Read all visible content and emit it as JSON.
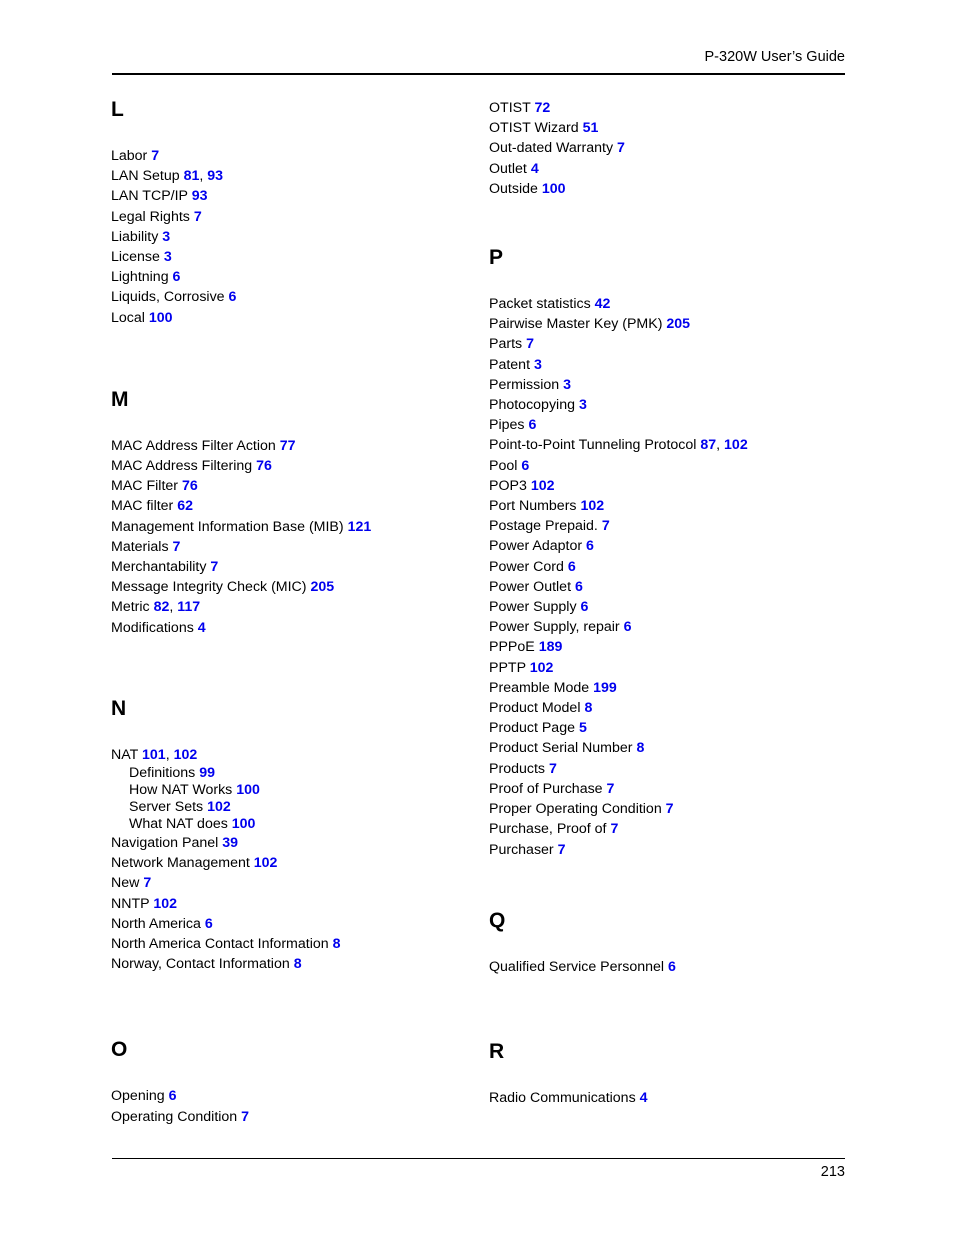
{
  "header": {
    "title": "P-320W User’s Guide"
  },
  "footer": {
    "page_number": "213"
  },
  "colors": {
    "page_reference": "#0000ee",
    "text": "#000000",
    "background": "#ffffff"
  },
  "columns": {
    "left": [
      {
        "letter": "L",
        "gap_before": 0,
        "entries": [
          {
            "term": "Labor",
            "pages": [
              "7"
            ]
          },
          {
            "term": "LAN Setup",
            "pages": [
              "81",
              "93"
            ]
          },
          {
            "term": "LAN TCP/IP",
            "pages": [
              "93"
            ]
          },
          {
            "term": "Legal Rights",
            "pages": [
              "7"
            ]
          },
          {
            "term": "Liability",
            "pages": [
              "3"
            ]
          },
          {
            "term": "License",
            "pages": [
              "3"
            ]
          },
          {
            "term": "Lightning",
            "pages": [
              "6"
            ]
          },
          {
            "term": "Liquids, Corrosive",
            "pages": [
              "6"
            ]
          },
          {
            "term": "Local",
            "pages": [
              "100"
            ]
          }
        ]
      },
      {
        "letter": "M",
        "gap_before": 60,
        "entries": [
          {
            "term": "MAC Address Filter Action",
            "pages": [
              "77"
            ]
          },
          {
            "term": "MAC Address Filtering",
            "pages": [
              "76"
            ]
          },
          {
            "term": "MAC Filter",
            "pages": [
              "76"
            ]
          },
          {
            "term": "MAC filter",
            "pages": [
              "62"
            ]
          },
          {
            "term": "Management Information Base (MIB)",
            "pages": [
              "121"
            ]
          },
          {
            "term": "Materials",
            "pages": [
              "7"
            ]
          },
          {
            "term": "Merchantability",
            "pages": [
              "7"
            ]
          },
          {
            "term": "Message Integrity Check (MIC)",
            "pages": [
              "205"
            ]
          },
          {
            "term": "Metric",
            "pages": [
              "82",
              "117"
            ]
          },
          {
            "term": "Modifications",
            "pages": [
              "4"
            ]
          }
        ]
      },
      {
        "letter": "N",
        "gap_before": 59,
        "entries": [
          {
            "term": "NAT",
            "pages": [
              "101",
              "102"
            ]
          },
          {
            "term": "Definitions",
            "pages": [
              "99"
            ],
            "sub": true
          },
          {
            "term": "How NAT Works",
            "pages": [
              "100"
            ],
            "sub": true
          },
          {
            "term": "Server Sets",
            "pages": [
              "102"
            ],
            "sub": true
          },
          {
            "term": "What NAT does",
            "pages": [
              "100"
            ],
            "sub": true
          },
          {
            "term": "Navigation Panel",
            "pages": [
              "39"
            ]
          },
          {
            "term": "Network Management",
            "pages": [
              "102"
            ]
          },
          {
            "term": "New",
            "pages": [
              "7"
            ]
          },
          {
            "term": "NNTP",
            "pages": [
              "102"
            ]
          },
          {
            "term": "North America",
            "pages": [
              "6"
            ]
          },
          {
            "term": "North America Contact Information",
            "pages": [
              "8"
            ]
          },
          {
            "term": "Norway, Contact Information",
            "pages": [
              "8"
            ]
          }
        ]
      },
      {
        "letter": "O",
        "gap_before": 64,
        "entries": [
          {
            "term": "Opening",
            "pages": [
              "6"
            ]
          },
          {
            "term": "Operating Condition",
            "pages": [
              "7"
            ]
          }
        ]
      }
    ],
    "right": [
      {
        "letter": "",
        "gap_before": 0,
        "entries": [
          {
            "term": "OTIST",
            "pages": [
              "72"
            ]
          },
          {
            "term": "OTIST Wizard",
            "pages": [
              "51"
            ]
          },
          {
            "term": "Out-dated Warranty",
            "pages": [
              "7"
            ]
          },
          {
            "term": "Outlet",
            "pages": [
              "4"
            ]
          },
          {
            "term": "Outside",
            "pages": [
              "100"
            ]
          }
        ]
      },
      {
        "letter": "P",
        "gap_before": 47,
        "entries": [
          {
            "term": "Packet statistics",
            "pages": [
              "42"
            ]
          },
          {
            "term": "Pairwise Master Key (PMK)",
            "pages": [
              "205"
            ]
          },
          {
            "term": "Parts",
            "pages": [
              "7"
            ]
          },
          {
            "term": "Patent",
            "pages": [
              "3"
            ]
          },
          {
            "term": "Permission",
            "pages": [
              "3"
            ]
          },
          {
            "term": "Photocopying",
            "pages": [
              "3"
            ]
          },
          {
            "term": "Pipes",
            "pages": [
              "6"
            ]
          },
          {
            "term": "Point-to-Point Tunneling Protocol",
            "pages": [
              "87",
              "102"
            ]
          },
          {
            "term": "Pool",
            "pages": [
              "6"
            ]
          },
          {
            "term": "POP3",
            "pages": [
              "102"
            ]
          },
          {
            "term": "Port Numbers",
            "pages": [
              "102"
            ]
          },
          {
            "term": "Postage Prepaid.",
            "pages": [
              "7"
            ]
          },
          {
            "term": "Power Adaptor",
            "pages": [
              "6"
            ]
          },
          {
            "term": "Power Cord",
            "pages": [
              "6"
            ]
          },
          {
            "term": "Power Outlet",
            "pages": [
              "6"
            ]
          },
          {
            "term": "Power Supply",
            "pages": [
              "6"
            ]
          },
          {
            "term": "Power Supply, repair",
            "pages": [
              "6"
            ]
          },
          {
            "term": "PPPoE",
            "pages": [
              "189"
            ]
          },
          {
            "term": "PPTP",
            "pages": [
              "102"
            ]
          },
          {
            "term": "Preamble Mode",
            "pages": [
              "199"
            ]
          },
          {
            "term": "Product Model",
            "pages": [
              "8"
            ]
          },
          {
            "term": "Product Page",
            "pages": [
              "5"
            ]
          },
          {
            "term": "Product Serial Number",
            "pages": [
              "8"
            ]
          },
          {
            "term": "Products",
            "pages": [
              "7"
            ]
          },
          {
            "term": "Proof of Purchase",
            "pages": [
              "7"
            ]
          },
          {
            "term": "Proper Operating Condition",
            "pages": [
              "7"
            ]
          },
          {
            "term": "Purchase, Proof of",
            "pages": [
              "7"
            ]
          },
          {
            "term": "Purchaser",
            "pages": [
              "7"
            ]
          }
        ]
      },
      {
        "letter": "Q",
        "gap_before": 49,
        "entries": [
          {
            "term": "Qualified Service Personnel",
            "pages": [
              "6"
            ]
          }
        ]
      },
      {
        "letter": "R",
        "gap_before": 63,
        "entries": [
          {
            "term": "Radio Communications",
            "pages": [
              "4"
            ]
          }
        ]
      }
    ]
  }
}
